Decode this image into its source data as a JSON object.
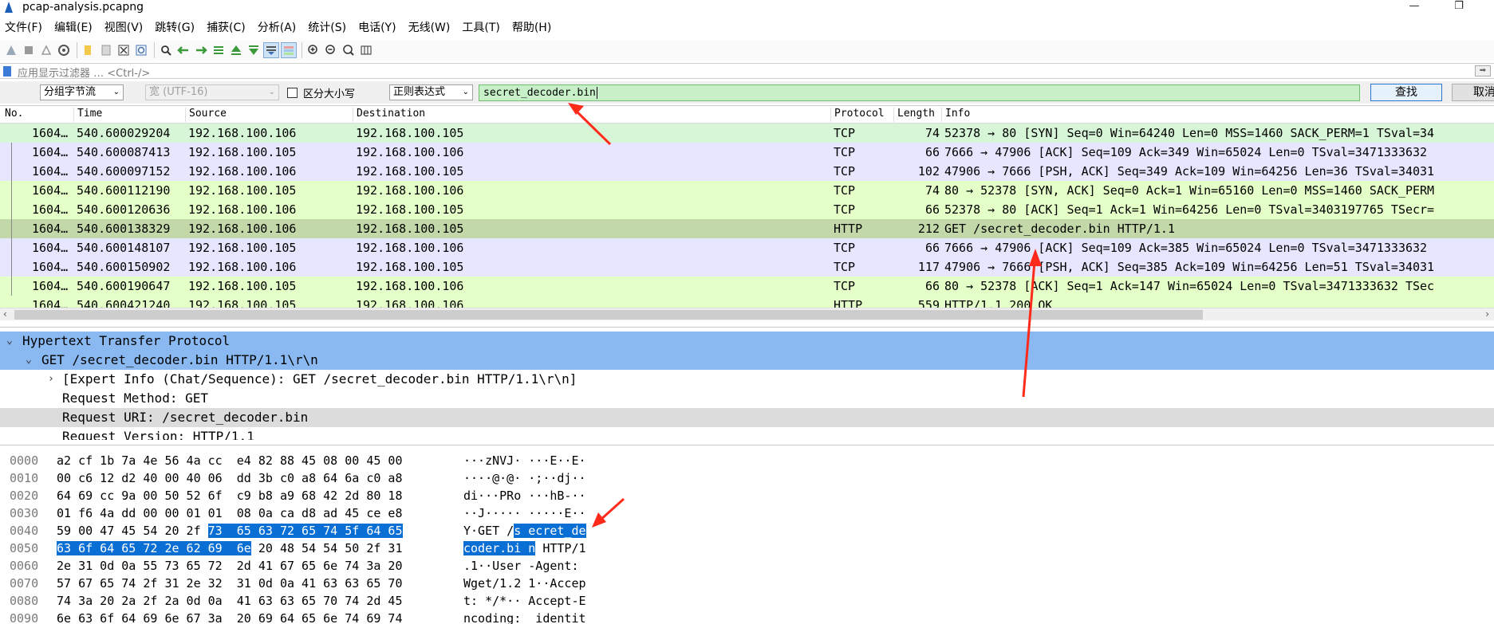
{
  "window": {
    "title": "pcap-analysis.pcapng",
    "minimize_glyph": "—",
    "restore_glyph": "❐"
  },
  "menu": [
    "文件(F)",
    "编辑(E)",
    "视图(V)",
    "跳转(G)",
    "捕获(C)",
    "分析(A)",
    "统计(S)",
    "电话(Y)",
    "无线(W)",
    "工具(T)",
    "帮助(H)"
  ],
  "filter": {
    "placeholder": "应用显示过滤器 … <Ctrl-/>",
    "apply_glyph": "➡"
  },
  "find": {
    "search_in": "分组字节流",
    "encoding": "宽 (UTF-16)",
    "case_label": "区分大小写",
    "mode": "正则表达式",
    "query": "secret_decoder.bin",
    "find_label": "查找",
    "cancel_label": "取消"
  },
  "columns": {
    "no": "No.",
    "time": "Time",
    "source": "Source",
    "destination": "Destination",
    "protocol": "Protocol",
    "length": "Length",
    "info": "Info"
  },
  "packets": [
    {
      "no": "1604…",
      "time": "540.600029204",
      "src": "192.168.100.106",
      "dst": "192.168.100.105",
      "proto": "TCP",
      "len": "74",
      "info": "52378 → 80 [SYN] Seq=0 Win=64240 Len=0 MSS=1460 SACK_PERM=1 TSval=34",
      "color": "#d7f5d7"
    },
    {
      "no": "1604…",
      "time": "540.600087413",
      "src": "192.168.100.105",
      "dst": "192.168.100.106",
      "proto": "TCP",
      "len": "66",
      "info": "7666 → 47906 [ACK] Seq=109 Ack=349 Win=65024 Len=0 TSval=3471333632",
      "color": "#e7e6ff"
    },
    {
      "no": "1604…",
      "time": "540.600097152",
      "src": "192.168.100.106",
      "dst": "192.168.100.105",
      "proto": "TCP",
      "len": "102",
      "info": "47906 → 7666 [PSH, ACK] Seq=349 Ack=109 Win=64256 Len=36 TSval=34031",
      "color": "#e7e6ff"
    },
    {
      "no": "1604…",
      "time": "540.600112190",
      "src": "192.168.100.105",
      "dst": "192.168.100.106",
      "proto": "TCP",
      "len": "74",
      "info": "80 → 52378 [SYN, ACK] Seq=0 Ack=1 Win=65160 Len=0 MSS=1460 SACK_PERM",
      "color": "#e4ffc7"
    },
    {
      "no": "1604…",
      "time": "540.600120636",
      "src": "192.168.100.106",
      "dst": "192.168.100.105",
      "proto": "TCP",
      "len": "66",
      "info": "52378 → 80 [ACK] Seq=1 Ack=1 Win=64256 Len=0 TSval=3403197765 TSecr=",
      "color": "#e4ffc7"
    },
    {
      "no": "1604…",
      "time": "540.600138329",
      "src": "192.168.100.106",
      "dst": "192.168.100.105",
      "proto": "HTTP",
      "len": "212",
      "info": "GET /secret_decoder.bin HTTP/1.1",
      "color": "#c2d8a8"
    },
    {
      "no": "1604…",
      "time": "540.600148107",
      "src": "192.168.100.105",
      "dst": "192.168.100.106",
      "proto": "TCP",
      "len": "66",
      "info": "7666 → 47906 [ACK] Seq=109 Ack=385 Win=65024 Len=0 TSval=3471333632",
      "color": "#e7e6ff"
    },
    {
      "no": "1604…",
      "time": "540.600150902",
      "src": "192.168.100.106",
      "dst": "192.168.100.105",
      "proto": "TCP",
      "len": "117",
      "info": "47906 → 7666 [PSH, ACK] Seq=385 Ack=109 Win=64256 Len=51 TSval=34031",
      "color": "#e7e6ff"
    },
    {
      "no": "1604…",
      "time": "540.600190647",
      "src": "192.168.100.105",
      "dst": "192.168.100.106",
      "proto": "TCP",
      "len": "66",
      "info": "80 → 52378 [ACK] Seq=1 Ack=147 Win=65024 Len=0 TSval=3471333632 TSec",
      "color": "#e4ffc7"
    },
    {
      "no": "1604…",
      "time": "540.600421240",
      "src": "192.168.100.105",
      "dst": "192.168.100.106",
      "proto": "HTTP",
      "len": "559",
      "info": "HTTP/1.1 200 OK",
      "color": "#e4ffc7"
    }
  ],
  "details": [
    {
      "level": 0,
      "expander": "⌄",
      "text": "Hypertext Transfer Protocol",
      "bg": "#8ab8f0"
    },
    {
      "level": 1,
      "expander": "⌄",
      "text": "GET /secret_decoder.bin HTTP/1.1\\r\\n",
      "bg": "#8ab8f0"
    },
    {
      "level": 2,
      "expander": "›",
      "text": "[Expert Info (Chat/Sequence): GET /secret_decoder.bin HTTP/1.1\\r\\n]",
      "bg": "#ffffff"
    },
    {
      "level": 2,
      "expander": "",
      "text": "Request Method: GET",
      "bg": "#ffffff"
    },
    {
      "level": 2,
      "expander": "",
      "text": "Request URI: /secret_decoder.bin",
      "bg": "#dcdcdc"
    },
    {
      "level": 2,
      "expander": "",
      "text": "Request Version: HTTP/1.1",
      "bg": "#ffffff"
    }
  ],
  "bytes": [
    {
      "off": "0000",
      "hex": "a2 cf 1b 7a 4e 56 4a cc  e4 82 88 45 08 00 45 00",
      "asc": "···zNVJ· ···E··E·"
    },
    {
      "off": "0010",
      "hex": "00 c6 12 d2 40 00 40 06  dd 3b c0 a8 64 6a c0 a8",
      "asc": "····@·@· ·;··dj··"
    },
    {
      "off": "0020",
      "hex": "64 69 cc 9a 00 50 52 6f  c9 b8 a9 68 42 2d 80 18",
      "asc": "di···PRo ···hB-··"
    },
    {
      "off": "0030",
      "hex": "01 f6 4a dd 00 00 01 01  08 0a ca d8 ad 45 ce e8",
      "asc": "··J····· ·····E··"
    },
    {
      "off": "0040",
      "hex_pre": "59 00 47 45 54 20 2f ",
      "hex_hl": "73  65 63 72 65 74 5f 64 65",
      "asc_pre": "Y·GET /",
      "asc_hl": "s ecret_de",
      "hex": "",
      "asc": ""
    },
    {
      "off": "0050",
      "hex_hl": "63 6f 64 65 72 2e 62 69  6e",
      "hex_post": " 20 48 54 54 50 2f 31",
      "asc_hl": "coder.bi n",
      "asc_post": " HTTP/1",
      "hex": "",
      "asc": ""
    },
    {
      "off": "0060",
      "hex": "2e 31 0d 0a 55 73 65 72  2d 41 67 65 6e 74 3a 20",
      "asc": ".1··User -Agent: "
    },
    {
      "off": "0070",
      "hex": "57 67 65 74 2f 31 2e 32  31 0d 0a 41 63 63 65 70",
      "asc": "Wget/1.2 1··Accep"
    },
    {
      "off": "0080",
      "hex": "74 3a 20 2a 2f 2a 0d 0a  41 63 63 65 70 74 2d 45",
      "asc": "t: */*·· Accept-E"
    },
    {
      "off": "0090",
      "hex": "6e 63 6f 64 69 6e 67 3a  20 69 64 65 6e 74 69 74",
      "asc": "ncoding:  identit"
    }
  ],
  "colors": {
    "selection": "#0a6fd4",
    "annotation": "#ff2a1a",
    "search_match": "#c8f0c8"
  }
}
